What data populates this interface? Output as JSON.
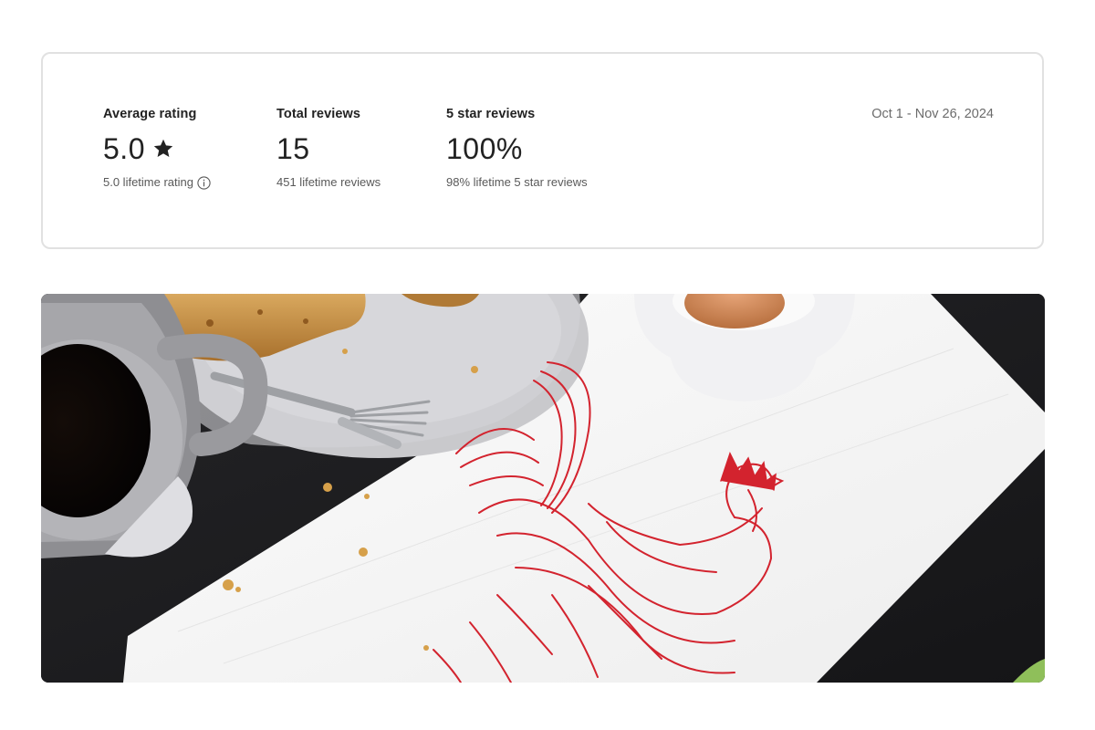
{
  "stats": {
    "average_rating": {
      "label": "Average rating",
      "value": "5.0",
      "icon": "star-icon",
      "sub": "5.0 lifetime rating",
      "sub_icon": "info-icon"
    },
    "total_reviews": {
      "label": "Total reviews",
      "value": "15",
      "sub": "451 lifetime reviews"
    },
    "five_star_reviews": {
      "label": "5 star reviews",
      "value": "100%",
      "sub": "98% lifetime 5 star reviews"
    },
    "date_range": "Oct 1 - Nov 26, 2024"
  },
  "photo": {
    "subject": "breakfast-table-with-rooster-print-towel"
  },
  "colors": {
    "card_border": "#e1e1e1",
    "text_primary": "#222222",
    "text_secondary": "#595959",
    "rooster_red": "#d3232e",
    "table_dark": "#1c1c1e"
  }
}
